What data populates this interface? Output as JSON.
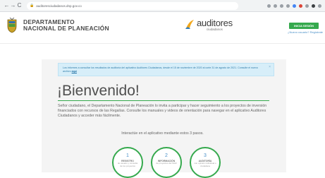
{
  "browser": {
    "url": "auditoresciudadanos.dnp.gov.co",
    "back_glyph": "←",
    "forward_glyph": "→",
    "reload_glyph": "C",
    "lock_glyph": "🔒"
  },
  "header": {
    "org_line1": "DEPARTAMENTO",
    "org_line2": "NACIONAL DE PLANEACIÓN",
    "brand_title": "auditores",
    "brand_subtitle": "ciudadanos",
    "login_label": "INICIA SESIÓN",
    "register_label": "¿Nuevo usuario? Regístrate",
    "accent_green": "#35a94d"
  },
  "alert": {
    "text": "Los informes a consultar los resultados de auditoría del aplicativo Auditores Ciudadanos, desde el 15 de noviembre de 2020 al corte 31 de agosto de 2021. Consulte el nuevo archivo",
    "link_label": "aquí",
    "close_glyph": "×"
  },
  "main": {
    "welcome": "¡Bienvenido!",
    "intro": "Señor ciudadano, el Departamento Nacional de Planeación lo invita a participar y hacer seguimiento a los proyectos de inversión financiados con recursos de las Regalías. Consulte los manuales y videos de orientación para navegar en el aplicativo Auditores Ciudadanos y acceder más fácilmente.",
    "interact": "Interactúe en el aplicativo mediante estos 3 pasos."
  },
  "steps": [
    {
      "number": "1",
      "title": "REGISTRO",
      "desc": "de usuario y consulta de los proyectos"
    },
    {
      "number": "2",
      "title": "INFORMACIÓN",
      "desc": "de proyectos del SGR"
    },
    {
      "number": "3",
      "title": "AUDITORÍA",
      "desc": "con opinión individual o ciudadana"
    }
  ]
}
